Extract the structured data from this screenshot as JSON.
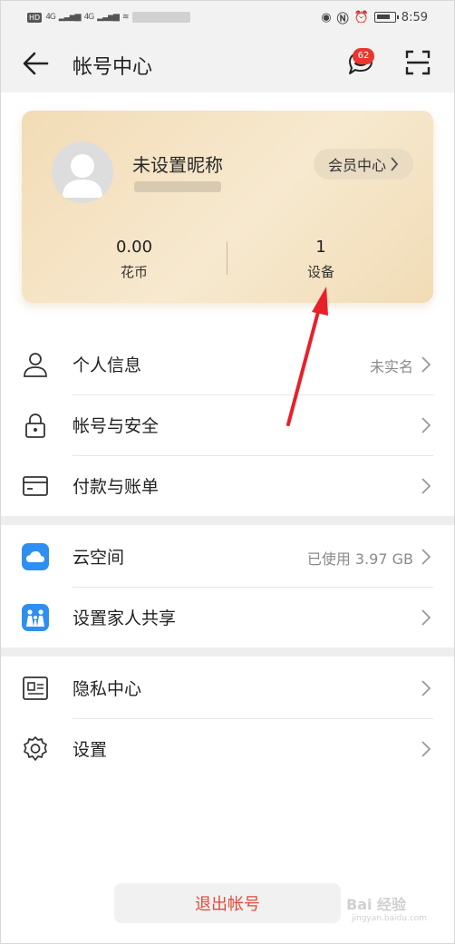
{
  "status_bar": {
    "network_1": "4G",
    "network_2": "4G",
    "time": "8:59",
    "hd": "HD"
  },
  "header": {
    "title": "帐号中心",
    "message_badge": "62"
  },
  "profile": {
    "nickname": "未设置昵称",
    "member_center_label": "会员中心",
    "stats": [
      {
        "value": "0.00",
        "label": "花币"
      },
      {
        "value": "1",
        "label": "设备"
      }
    ]
  },
  "menu": {
    "personal_info": {
      "label": "个人信息",
      "value": "未实名"
    },
    "account_security": {
      "label": "帐号与安全"
    },
    "payment_bills": {
      "label": "付款与账单"
    },
    "cloud_space": {
      "label": "云空间",
      "value": "已使用 3.97 GB"
    },
    "family_sharing": {
      "label": "设置家人共享"
    },
    "privacy_center": {
      "label": "隐私中心"
    },
    "settings": {
      "label": "设置"
    }
  },
  "logout_label": "退出帐号",
  "watermark": {
    "main": "Bai 经验",
    "sub": "jingyan.baidu.com"
  },
  "colors": {
    "accent_red": "#e04b3c",
    "badge_red": "#e8372e",
    "card_gold": "#f2dcb6",
    "cloud_blue": "#2f8ff0",
    "annotation_arrow": "#e8202a"
  },
  "icons": {
    "back": "arrow-left-icon",
    "message": "chat-bubble-icon",
    "scan": "scan-icon",
    "personal_info": "person-icon",
    "account_security": "lock-icon",
    "payment": "card-icon",
    "cloud": "cloud-icon",
    "family": "family-icon",
    "privacy": "id-card-icon",
    "settings": "gear-icon"
  }
}
